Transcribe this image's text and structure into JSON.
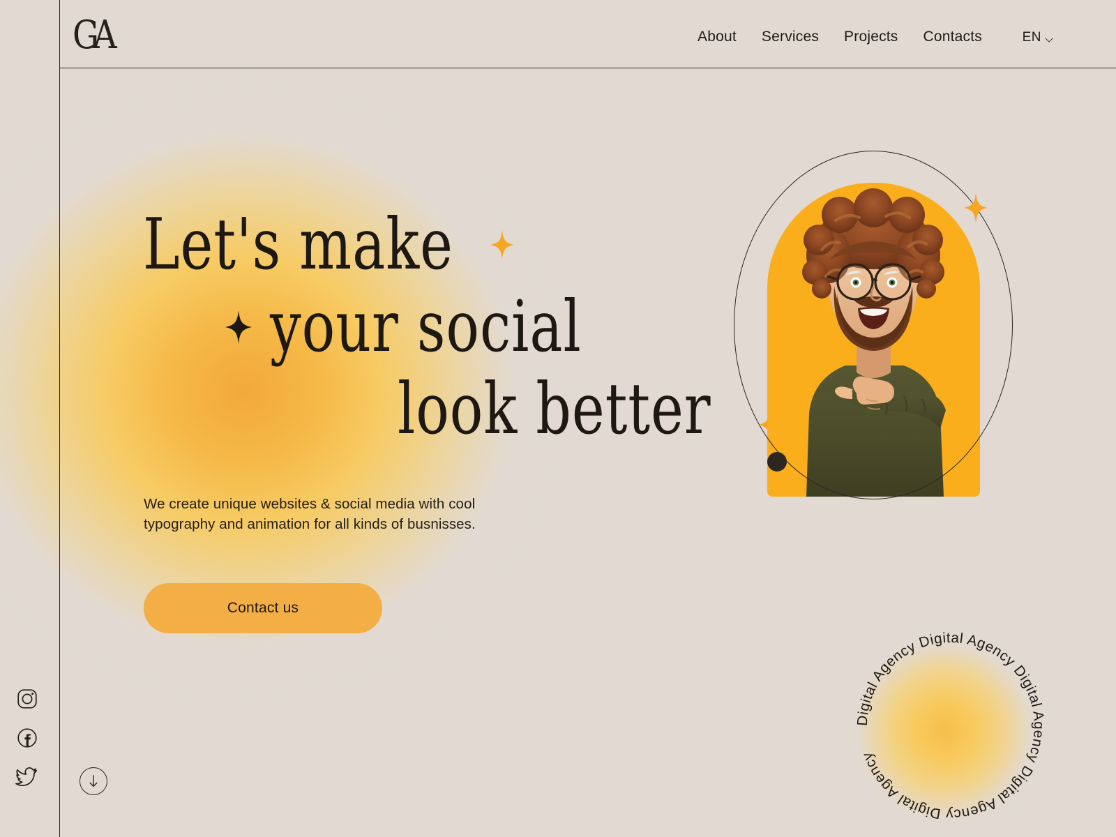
{
  "brand": {
    "logo_text": "GA",
    "background_color": "#E2DAD2",
    "accent_color": "#F3AE45",
    "photo_bg_color": "#FBAE1C",
    "ink_color": "#1E1812"
  },
  "header": {
    "nav": [
      {
        "label": "About"
      },
      {
        "label": "Services"
      },
      {
        "label": "Projects"
      },
      {
        "label": "Contacts"
      }
    ],
    "language": {
      "value": "EN",
      "chevron_icon": "chevron-down-icon"
    }
  },
  "hero": {
    "headline": {
      "line1": "Let's make",
      "line2": "your social",
      "line3": "look better"
    },
    "sparkles": [
      {
        "name": "sparkle-after-line1",
        "color": "#F5A623"
      },
      {
        "name": "sparkle-before-line2",
        "color": "#1E1812"
      },
      {
        "name": "sparkle-after-line3",
        "color": "#F5A623"
      }
    ],
    "paragraph": "We create unique websites & social media with cool\ntypography and animation  for all kinds of busnisses.",
    "cta": {
      "label": "Contact us"
    }
  },
  "portrait": {
    "alt": "Smiling bearded man with curly hair and glasses pointing to the side",
    "ring_star_color": "#F5A623",
    "ring_dot_color": "#2E2721"
  },
  "badge": {
    "circular_text": "Digital Agency Digital Agency Digital Agency Digital Agency Digital Agency "
  },
  "social": [
    {
      "name": "instagram-icon",
      "label": "Instagram"
    },
    {
      "name": "facebook-icon",
      "label": "Facebook"
    },
    {
      "name": "twitter-icon",
      "label": "Twitter"
    }
  ],
  "scroll": {
    "icon": "arrow-down-icon",
    "label": "Scroll down"
  }
}
